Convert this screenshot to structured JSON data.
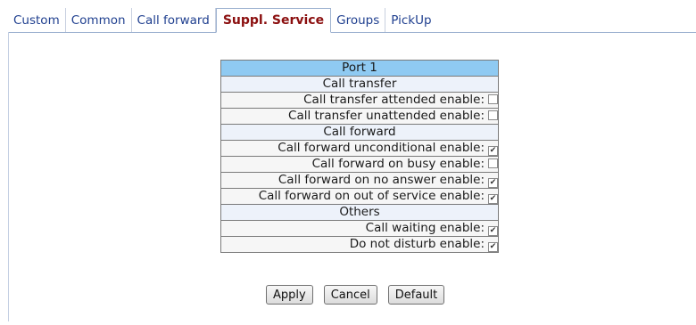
{
  "tabs": [
    {
      "label": "Custom",
      "active": false
    },
    {
      "label": "Common",
      "active": false
    },
    {
      "label": "Call forward",
      "active": false
    },
    {
      "label": "Suppl. Service",
      "active": true
    },
    {
      "label": "Groups",
      "active": false
    },
    {
      "label": "PickUp",
      "active": false
    }
  ],
  "port_title": "Port 1",
  "sections": {
    "call_transfer": {
      "title": "Call transfer",
      "rows": [
        {
          "label": "Call transfer attended enable:",
          "checked": false
        },
        {
          "label": "Call transfer unattended enable:",
          "checked": false
        }
      ]
    },
    "call_forward": {
      "title": "Call forward",
      "rows": [
        {
          "label": "Call forward unconditional enable:",
          "checked": true
        },
        {
          "label": "Call forward on busy enable:",
          "checked": false
        },
        {
          "label": "Call forward on no answer enable:",
          "checked": true
        },
        {
          "label": "Call forward on out of service enable:",
          "checked": true
        }
      ]
    },
    "others": {
      "title": "Others",
      "rows": [
        {
          "label": "Call waiting enable:",
          "checked": true
        },
        {
          "label": "Do not disturb enable:",
          "checked": true
        }
      ]
    }
  },
  "buttons": {
    "apply": "Apply",
    "cancel": "Cancel",
    "default": "Default"
  },
  "colors": {
    "tab_link": "#1f3f8f",
    "tab_active": "#8b0f0f",
    "port_header_bg": "#8fcaf2",
    "section_bg": "#edf2fa"
  }
}
